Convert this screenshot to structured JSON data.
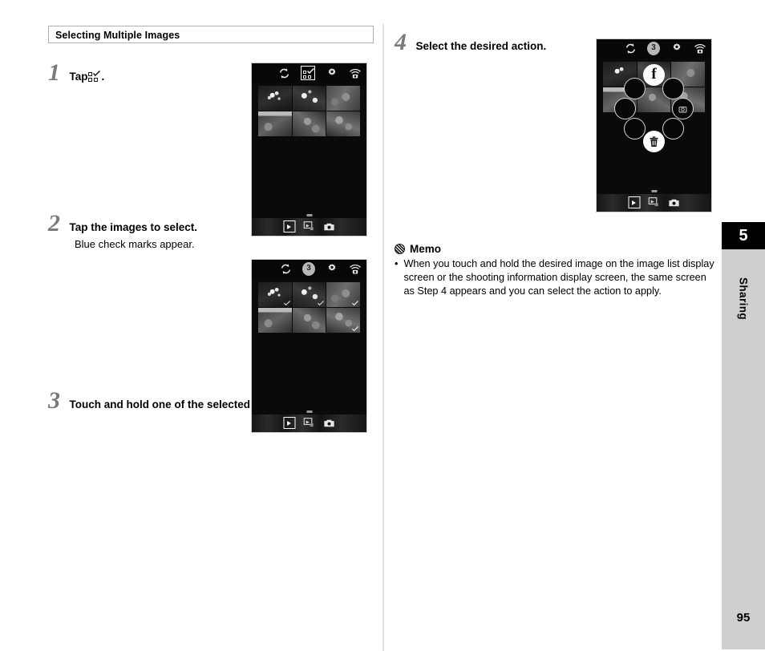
{
  "section": {
    "header": "Selecting Multiple Images"
  },
  "steps": {
    "one": {
      "num": "1",
      "title_prefix": "Tap",
      "title_suffix": ".",
      "icon": "grid-check-icon"
    },
    "two": {
      "num": "2",
      "title": "Tap the images to select.",
      "sub": "Blue check marks appear."
    },
    "three": {
      "num": "3",
      "title": "Touch and hold one of the selected images."
    },
    "four": {
      "num": "4",
      "title": "Select the desired action."
    }
  },
  "screens": {
    "step1": {
      "name": "image-list-screen",
      "topbar": {
        "sync_icon": "sync-icon",
        "select_icon": "grid-check-icon",
        "select_icon_selected": true,
        "badge": "",
        "settings_icon": "gear-icon",
        "wifi_icon": "wifi-camera-icon"
      },
      "thumbnails": [
        {
          "checked": false
        },
        {
          "checked": false
        },
        {
          "checked": false
        },
        {
          "checked": false
        },
        {
          "checked": false
        },
        {
          "checked": false
        }
      ],
      "bottombar": {
        "playback_icon": "playback-icon",
        "playback_selected": true,
        "gallery_icon": "gallery-icon",
        "camera_icon": "camera-icon"
      }
    },
    "step2": {
      "name": "image-list-selected-screen",
      "topbar": {
        "sync_icon": "sync-icon",
        "badge": "3",
        "settings_icon": "gear-icon",
        "wifi_icon": "wifi-camera-icon"
      },
      "thumbnails": [
        {
          "checked": true
        },
        {
          "checked": true
        },
        {
          "checked": true
        },
        {
          "checked": false
        },
        {
          "checked": false
        },
        {
          "checked": true
        }
      ],
      "bottombar": {
        "playback_icon": "playback-icon",
        "playback_selected": true,
        "gallery_icon": "gallery-icon",
        "camera_icon": "camera-icon"
      }
    },
    "step4": {
      "name": "action-menu-screen",
      "topbar": {
        "sync_icon": "sync-icon",
        "badge": "3",
        "settings_icon": "gear-icon",
        "wifi_icon": "wifi-camera-icon"
      },
      "radial_menu": [
        {
          "id": "facebook",
          "label": "f",
          "style": "white"
        },
        {
          "id": "action-upper-left",
          "label": "",
          "style": "dark"
        },
        {
          "id": "action-upper-right",
          "label": "",
          "style": "dark"
        },
        {
          "id": "action-mid-left",
          "label": "",
          "style": "dark"
        },
        {
          "id": "action-mid-right",
          "label": "",
          "style": "dark"
        },
        {
          "id": "action-lower-left",
          "label": "",
          "style": "dark"
        },
        {
          "id": "action-lower-right",
          "label": "",
          "style": "dark"
        },
        {
          "id": "delete",
          "label": "",
          "style": "white"
        }
      ],
      "bottombar": {
        "playback_icon": "playback-icon",
        "playback_selected": true,
        "gallery_icon": "gallery-icon",
        "camera_icon": "camera-icon"
      }
    }
  },
  "memo": {
    "title": "Memo",
    "bullet": "•",
    "items": [
      "When you touch and hold the desired image on the image list display screen or the shooting information display screen, the same screen as Step 4 appears and you can select the action to apply."
    ]
  },
  "sidebar": {
    "chapter": "5",
    "label": "Sharing",
    "page": "95"
  }
}
